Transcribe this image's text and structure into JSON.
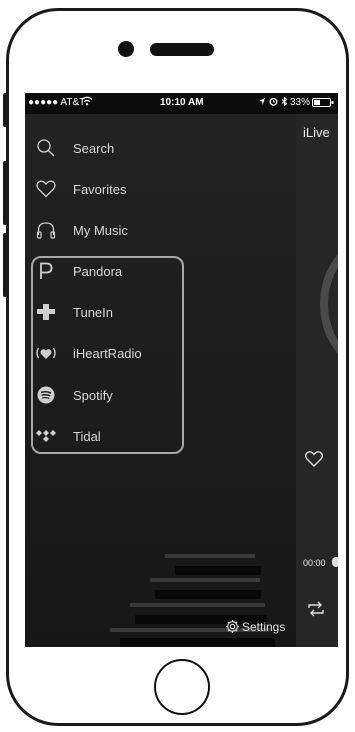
{
  "status_bar": {
    "carrier": "●●●●● AT&T",
    "time": "10:10 AM",
    "battery": "33%"
  },
  "menu": {
    "items": [
      {
        "label": "Search",
        "icon": "search-icon"
      },
      {
        "label": "Favorites",
        "icon": "heart-icon"
      },
      {
        "label": "My Music",
        "icon": "headphones-icon"
      },
      {
        "label": "Pandora",
        "icon": "pandora-icon"
      },
      {
        "label": "TuneIn",
        "icon": "tunein-icon"
      },
      {
        "label": "iHeartRadio",
        "icon": "iheartradio-icon"
      },
      {
        "label": "Spotify",
        "icon": "spotify-icon"
      },
      {
        "label": "Tidal",
        "icon": "tidal-icon"
      }
    ],
    "settings_label": "Settings"
  },
  "player": {
    "title": "iLive",
    "time": "00:00"
  },
  "colors": {
    "screen_bg": "#1d1d1d",
    "highlight_border": "#a8a8a8",
    "text": "#d8d8d8"
  }
}
